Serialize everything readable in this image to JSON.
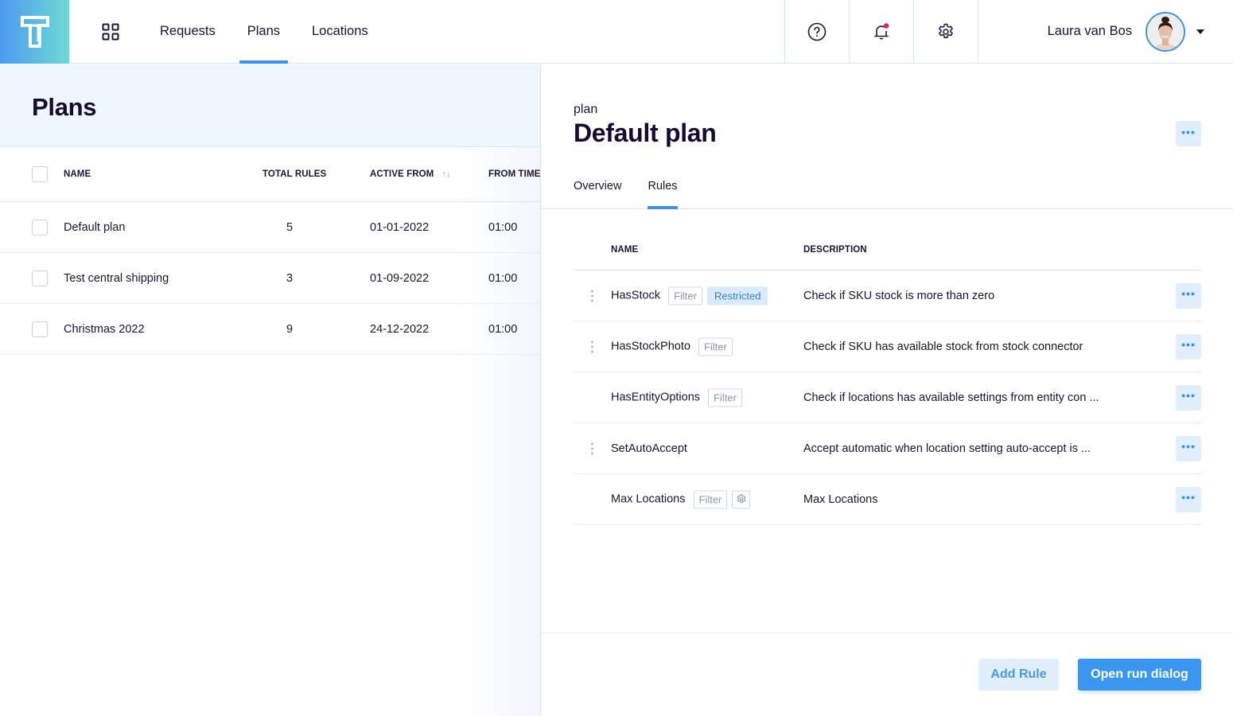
{
  "topbar": {
    "nav": [
      {
        "label": "Requests",
        "active": false
      },
      {
        "label": "Plans",
        "active": true
      },
      {
        "label": "Locations",
        "active": false
      }
    ],
    "icons": [
      "help-icon",
      "bell-icon",
      "settings-icon"
    ],
    "notification_dot_color": "#e6196e",
    "user_name": "Laura van Bos"
  },
  "plans_panel": {
    "title": "Plans",
    "columns": [
      "NAME",
      "TOTAL RULES",
      "ACTIVE FROM",
      "FROM TIME"
    ],
    "rows": [
      {
        "name": "Default plan",
        "total_rules": "5",
        "active_from": "01-01-2022",
        "from_time": "01:00"
      },
      {
        "name": "Test central shipping",
        "total_rules": "3",
        "active_from": "01-09-2022",
        "from_time": "01:00"
      },
      {
        "name": "Christmas 2022",
        "total_rules": "9",
        "active_from": "24-12-2022",
        "from_time": "01:00"
      }
    ]
  },
  "detail": {
    "kicker": "plan",
    "title": "Default plan",
    "more_label": "•••",
    "tabs": [
      {
        "label": "Overview",
        "active": false
      },
      {
        "label": "Rules",
        "active": true
      }
    ],
    "rules_columns": [
      "NAME",
      "DESCRIPTION"
    ],
    "rules": [
      {
        "name": "HasStock",
        "tags": [
          "Filter",
          "Restricted"
        ],
        "draggable": true,
        "settings": false,
        "description": "Check if SKU stock is more than zero"
      },
      {
        "name": "HasStockPhoto",
        "tags": [
          "Filter"
        ],
        "draggable": true,
        "settings": false,
        "description": "Check if SKU has available stock from stock connector"
      },
      {
        "name": "HasEntityOptions",
        "tags": [
          "Filter"
        ],
        "draggable": false,
        "settings": false,
        "description": "Check if locations has available settings from entity con ..."
      },
      {
        "name": "SetAutoAccept",
        "tags": [],
        "draggable": true,
        "settings": false,
        "description": "Accept automatic when location setting auto-accept is ..."
      },
      {
        "name": "Max Locations",
        "tags": [
          "Filter"
        ],
        "draggable": false,
        "settings": true,
        "description": "Max Locations"
      }
    ],
    "buttons": {
      "add_rule": "Add Rule",
      "open_run_dialog": "Open run dialog"
    }
  },
  "colors": {
    "accent": "#3a93e8",
    "primary_button": "#3a96ee",
    "secondary_button_bg": "#e1effd",
    "header_bg": "#eef6ff",
    "text_dark": "#150b30"
  }
}
